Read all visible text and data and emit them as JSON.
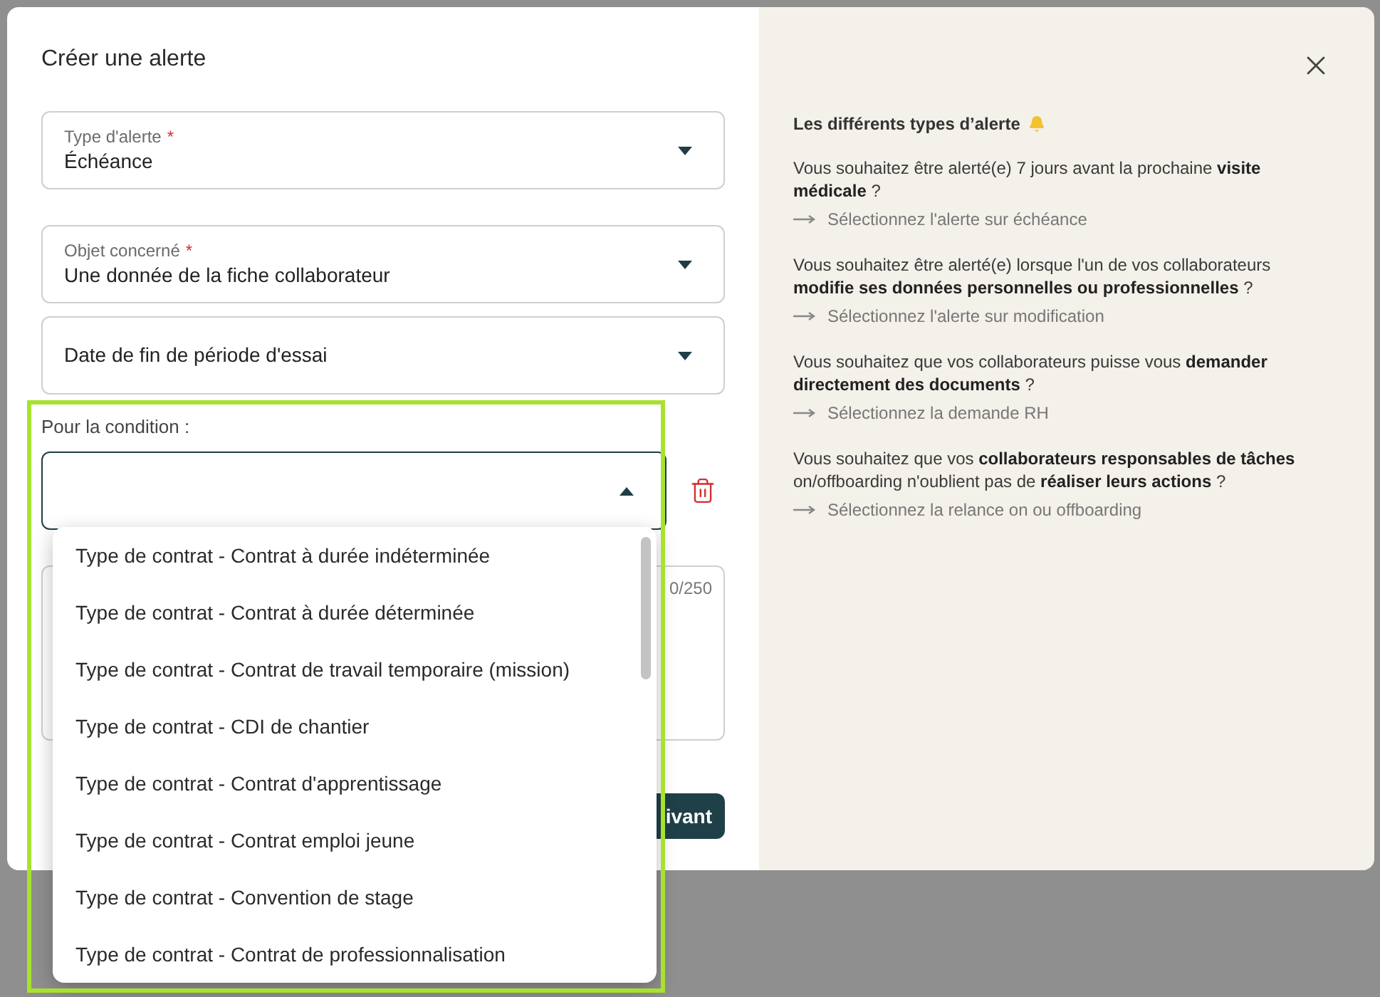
{
  "dialog": {
    "title": "Créer une alerte"
  },
  "fields": [
    {
      "kind": "select",
      "label": "Type d'alerte",
      "required_mark": "*",
      "value": "Échéance"
    },
    {
      "kind": "select",
      "label": "Objet concerné",
      "required_mark": "*",
      "value": "Une donnée de la fiche collaborateur"
    },
    {
      "kind": "select",
      "value": "Date de fin de période d'essai"
    }
  ],
  "condition": {
    "label": "Pour la condition :",
    "expanded": true,
    "options": [
      {
        "label": "Type de contrat - Contrat à durée indéterminée"
      },
      {
        "label": "Type de contrat - Contrat à durée déterminée"
      },
      {
        "label": "Type de contrat - Contrat de travail temporaire (mission)"
      },
      {
        "label": "Type de contrat - CDI de chantier"
      },
      {
        "label": "Type de contrat - Contrat d'apprentissage"
      },
      {
        "label": "Type de contrat - Contrat emploi jeune"
      },
      {
        "label": "Type de contrat - Convention de stage"
      },
      {
        "label": "Type de contrat - Contrat de professionnalisation"
      }
    ]
  },
  "comment": {
    "counter": "0/250"
  },
  "next_button": {
    "label": "ivant"
  },
  "help": {
    "title": "Les différents types d’alerte",
    "items": [
      {
        "question": "Vous souhaitez être alerté(e) 7 jours avant la prochaine **visite médicale** ?",
        "action": "Sélectionnez l'alerte sur échéance"
      },
      {
        "question": "Vous souhaitez être alerté(e) lorsque l'un de vos collaborateurs **modifie ses données personnelles ou professionnelles** ?",
        "action": "Sélectionnez l'alerte sur modification"
      },
      {
        "question": "Vous souhaitez que vos collaborateurs puisse vous **demander directement des documents** ?",
        "action": "Sélectionnez la demande RH"
      },
      {
        "question": "Vous souhaitez que vos **collaborateurs responsables de tâches** on/offboarding n'oublient pas de **réaliser leurs actions** ?",
        "action": "Sélectionnez la relance on ou offboarding"
      }
    ]
  }
}
